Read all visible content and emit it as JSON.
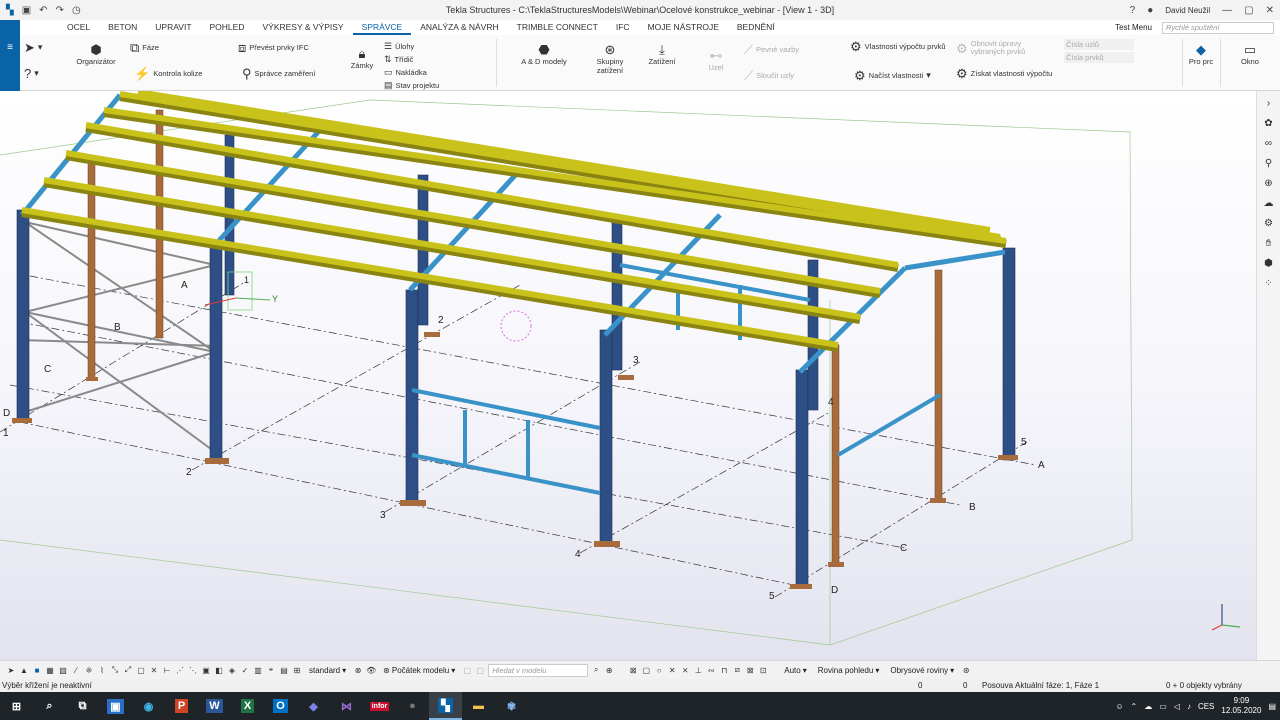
{
  "window": {
    "title": "Tekla Structures - C:\\TeklaStructuresModels\\Webinar\\Ocelové konstrukce_webinar - [View 1 - 3D]",
    "user": "David Neužil",
    "help_icon": "help-icon",
    "minimize_icon": "minimize-icon",
    "maximize_icon": "maximize-icon",
    "close_icon": "close-icon"
  },
  "ribbon_tabs": [
    "OCEL",
    "BETON",
    "UPRAVIT",
    "POHLED",
    "VÝKRESY & VÝPISY",
    "SPRÁVCE",
    "ANALÝZA & NÁVRH",
    "TRIMBLE CONNECT",
    "IFC",
    "MOJE NÁSTROJE",
    "BEDNĚNÍ"
  ],
  "active_tab": "SPRÁVCE",
  "test_menu": "Test Menu",
  "quick_launch_placeholder": "Rychlé spuštění",
  "ribbon": {
    "organizer": "Organizátor",
    "phases": "Fáze",
    "clash_check": "Kontrola kolize",
    "convert_ifc": "Převést prvky IFC",
    "survey_manager": "Správce zaměření",
    "locks": "Zámky",
    "tasks": "Úlohy",
    "sorter": "Třídič",
    "loading": "Nakládka",
    "project_status": "Stav projektu",
    "ad_models": "A & D modely",
    "load_groups": "Skupiny zatížení",
    "loads": "Zatížení",
    "node": "Uzel",
    "rigid_links": "Pevné vazby",
    "merge_nodes": "Sloučit uzly",
    "calc_props": "Vlastnosti výpočtu prvků",
    "load_props": "Načíst vlastnosti",
    "refresh_selected": "Obnovit úpravy vybraných prvků",
    "get_calc_props": "Získat vlastnosti výpočtu",
    "clear_nodes": "Čísla uzlů",
    "clear_parts": "Čísla prvků",
    "pro": "Pro prc",
    "window": "Okno"
  },
  "viewport": {
    "grid_letters": [
      "A",
      "B",
      "C",
      "D"
    ],
    "grid_numbers": [
      "1",
      "2",
      "3",
      "4",
      "5"
    ],
    "axis_y": "Y",
    "axis_one": "1",
    "colors": {
      "purlin": "#c9c21a",
      "column": "#2e4f86",
      "brace": "#3a93c8",
      "gable": "#a86b3c",
      "guide": "#333333"
    }
  },
  "bottom_toolbar": {
    "standard": "standard",
    "model_origin": "Počátek modelu",
    "search_placeholder": "Hledat v modelu",
    "auto": "Auto",
    "view_plane": "Rovina pohledu",
    "outline_planes": "Obrysové roviny"
  },
  "status": {
    "message": "Výběr křížení je neaktivní",
    "zero1": "0",
    "zero2": "0",
    "shift": "Posouva",
    "phase": "Aktuální fáze: 1, Fáze 1",
    "selected": "0 + 0 objekty vybrány"
  },
  "taskbar": {
    "apps": [
      "windows-start",
      "search",
      "task-view",
      "file-explorer-blue",
      "edge",
      "powerpoint",
      "word",
      "excel",
      "outlook",
      "teams",
      "visual-studio",
      "infor",
      "obs",
      "tekla",
      "folder",
      "tekla-alt"
    ],
    "lang": "CES",
    "time": "9:09",
    "date": "12.05.2020"
  }
}
